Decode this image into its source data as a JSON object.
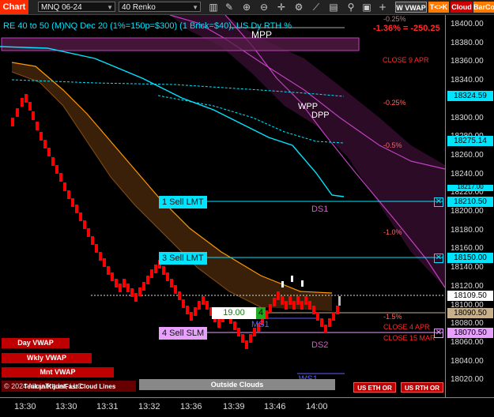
{
  "toolbar": {
    "chart_tab": "Chart",
    "symbol": "MNQ 06-24",
    "bar_type": "40 Renko",
    "vwap_btn": "W VWAP",
    "tk_btn": "T<>K",
    "cloud_btn": "Cloud",
    "barco_btn": "BarCo"
  },
  "chart": {
    "title": "RE 40 to 50 (M)NQ Dec 20 (1%=150p=$300) (1 Brick=$40), US Dy RTH %",
    "pct_change": "-1.36% = -250.25",
    "pct_ghost": "-0.25%",
    "levels": {
      "mpp": "MPP",
      "wpp": "WPP",
      "dpp": "DPP",
      "ds1": "DS1",
      "ds2": "DS2",
      "ms1": "MS1",
      "ws1": "WS1",
      "close9apr": "CLOSE 9 APR",
      "close4apr": "CLOSE 4 APR",
      "close15mar": "CLOSE 15 MAR",
      "p025": "-0.25%",
      "p05": "-0.5%",
      "p10": "-1.0%",
      "p15": "-1.5%"
    },
    "orders": [
      {
        "label": "1 Sell LMT",
        "price": 18210.5
      },
      {
        "label": "3 Sell LMT",
        "price": 18150.0
      },
      {
        "label": "4 Sell SLM",
        "price": 18070.5
      }
    ],
    "position_price": "19.00",
    "position_qty": "4",
    "buttons": {
      "day_vwap": "Day VWAP",
      "wkly_vwap": "Wkly VWAP",
      "mnt_vwap": "Mnt VWAP",
      "outside_clouds": "Outside Clouds",
      "us_eth_or": "US ETH OR",
      "us_rth_or": "US RTH OR"
    },
    "copyright": "© 2024 NinjaTrader, LLC",
    "copyright_overlay": "Tenkan/Kijun/Fast Cloud Lines"
  },
  "price_axis": {
    "ticks": [
      "18400.00",
      "18380.00",
      "18360.00",
      "18340.00",
      "18320.00",
      "18300.00",
      "18280.00",
      "18260.00",
      "18240.00",
      "18220.00",
      "18200.00",
      "18180.00",
      "18160.00",
      "18140.00",
      "18120.00",
      "18100.00",
      "18080.00",
      "18060.00",
      "18040.00",
      "18020.00"
    ],
    "tags": {
      "cyan1": "18324.59",
      "cyan2": "18275.14",
      "cyan3": "18210.50",
      "cyan4": "18150.00",
      "last": "18109.50",
      "tan": "18090.50",
      "pink": "18070.50",
      "partial": "18217.00"
    }
  },
  "time_axis": {
    "ticks": [
      "13:30",
      "13:30",
      "13:31",
      "13:32",
      "13:36",
      "13:39",
      "13:46",
      "14:00"
    ]
  },
  "colors": {
    "cyan": "#00e5ff",
    "red": "#ff0000",
    "magenta": "#c040c0",
    "orange": "#ff9900",
    "pink_tag": "#e8a0ff",
    "tan_tag": "#c8b08a"
  }
}
